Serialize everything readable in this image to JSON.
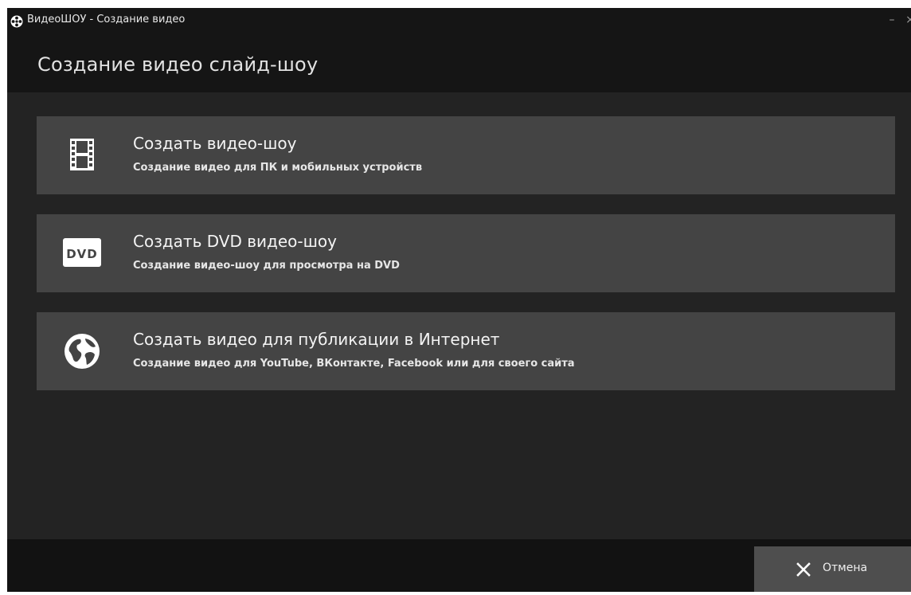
{
  "window": {
    "title": "ВидеоШОУ - Создание видео",
    "minimize_glyph": "–",
    "close_glyph": "×"
  },
  "page": {
    "title": "Создание видео слайд-шоу"
  },
  "options": [
    {
      "icon": "film-strip-icon",
      "title": "Создать видео-шоу",
      "description": "Создание видео для ПК и мобильных устройств"
    },
    {
      "icon": "dvd-icon",
      "title": "Создать DVD видео-шоу",
      "description": "Создание видео-шоу для просмотра на DVD",
      "icon_text": "DVD"
    },
    {
      "icon": "globe-icon",
      "title": "Создать видео для публикации в Интернет",
      "description": "Создание видео для YouTube, ВКонтакте, Facebook или для своего сайта"
    }
  ],
  "footer": {
    "cancel_label": "Отмена",
    "cancel_icon": "close-icon"
  },
  "colors": {
    "window_bg": "#232323",
    "header_bg": "#151515",
    "card_bg": "#444444",
    "footer_bg": "#121212",
    "cancel_bg": "#4e4e4e",
    "text": "#f4f4f4"
  }
}
